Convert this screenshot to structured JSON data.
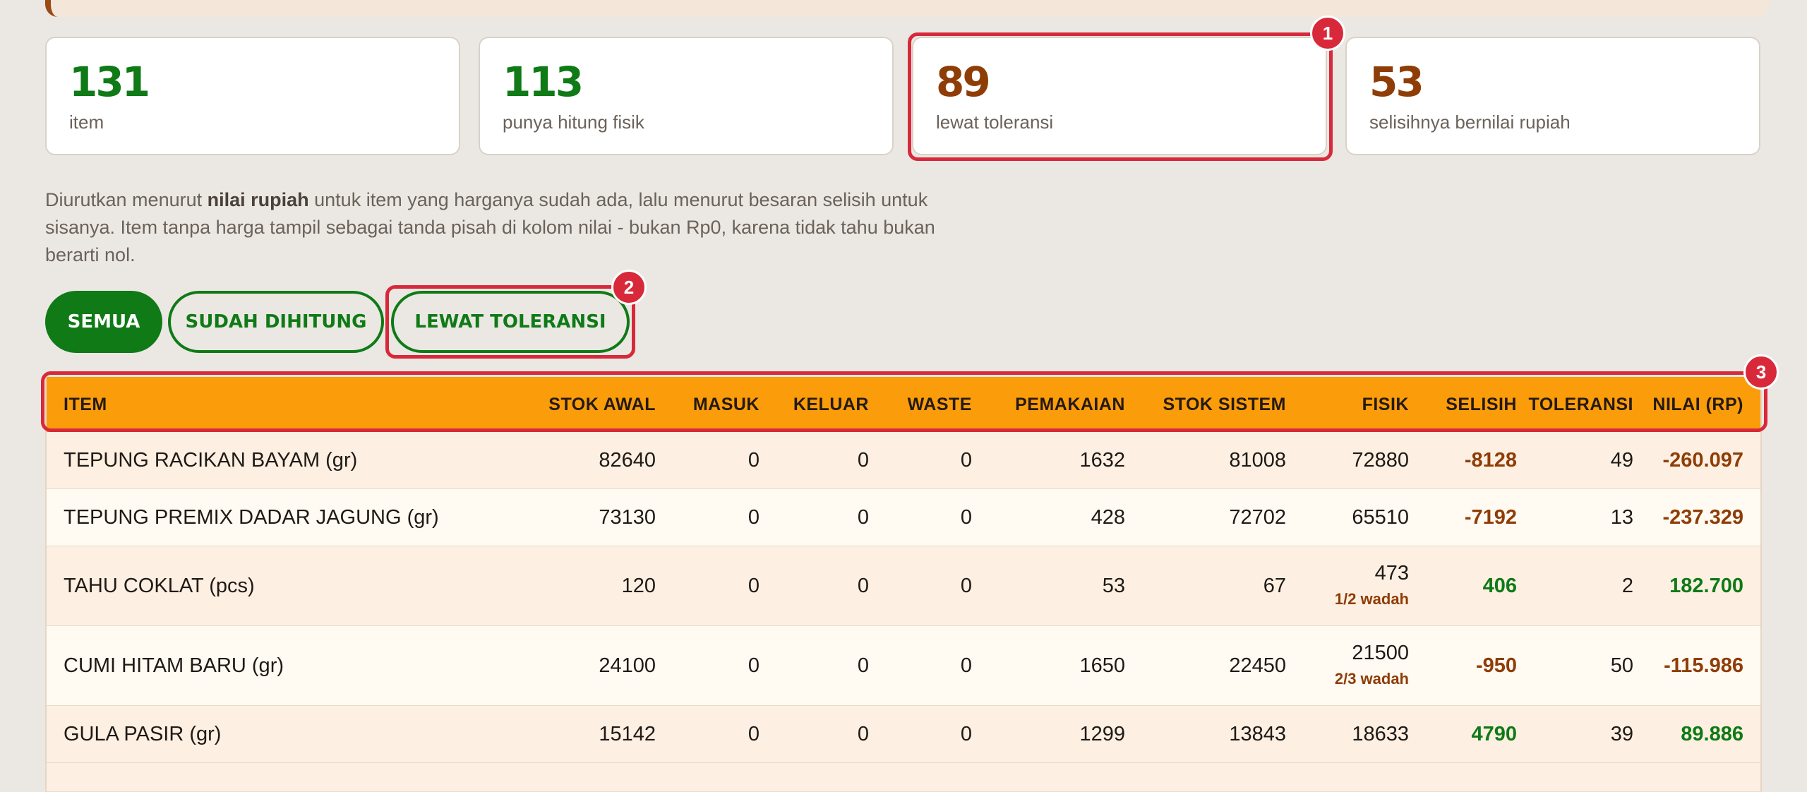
{
  "stats": [
    {
      "value": "131",
      "label": "item",
      "color": "#0f7a16"
    },
    {
      "value": "113",
      "label": "punya hitung fisik",
      "color": "#0f7a16"
    },
    {
      "value": "89",
      "label": "lewat toleransi",
      "color": "#8f3d07"
    },
    {
      "value": "53",
      "label": "selisihnya bernilai rupiah",
      "color": "#8f3d07"
    }
  ],
  "description": {
    "part1": "Diurutkan menurut ",
    "bold": "nilai rupiah",
    "part2": " untuk item yang harganya sudah ada, lalu menurut besaran selisih untuk sisanya. Item tanpa harga tampil sebagai tanda pisah di kolom nilai - bukan Rp0, karena tidak tahu bukan berarti nol."
  },
  "filters": [
    {
      "label": "SEMUA",
      "active": true
    },
    {
      "label": "SUDAH DIHITUNG",
      "active": false
    },
    {
      "label": "LEWAT TOLERANSI",
      "active": false
    }
  ],
  "badges": [
    "1",
    "2",
    "3"
  ],
  "table": {
    "headers": [
      "ITEM",
      "STOK AWAL",
      "MASUK",
      "KELUAR",
      "WASTE",
      "PEMAKAIAN",
      "STOK SISTEM",
      "FISIK",
      "SELISIH",
      "TOLERANSI",
      "NILAI (RP)"
    ],
    "rows": [
      {
        "item": "TEPUNG RACIKAN BAYAM (gr)",
        "stok_awal": "82640",
        "masuk": "0",
        "keluar": "0",
        "waste": "0",
        "pemakaian": "1632",
        "stok_sistem": "81008",
        "fisik": "72880",
        "fisik_sub": "",
        "selisih": "-8128",
        "toleransi": "49",
        "nilai": "-260.097",
        "sign": "neg"
      },
      {
        "item": "TEPUNG PREMIX DADAR JAGUNG (gr)",
        "stok_awal": "73130",
        "masuk": "0",
        "keluar": "0",
        "waste": "0",
        "pemakaian": "428",
        "stok_sistem": "72702",
        "fisik": "65510",
        "fisik_sub": "",
        "selisih": "-7192",
        "toleransi": "13",
        "nilai": "-237.329",
        "sign": "neg"
      },
      {
        "item": "TAHU COKLAT (pcs)",
        "stok_awal": "120",
        "masuk": "0",
        "keluar": "0",
        "waste": "0",
        "pemakaian": "53",
        "stok_sistem": "67",
        "fisik": "473",
        "fisik_sub": "1/2 wadah",
        "selisih": "406",
        "toleransi": "2",
        "nilai": "182.700",
        "sign": "pos"
      },
      {
        "item": "CUMI HITAM BARU (gr)",
        "stok_awal": "24100",
        "masuk": "0",
        "keluar": "0",
        "waste": "0",
        "pemakaian": "1650",
        "stok_sistem": "22450",
        "fisik": "21500",
        "fisik_sub": "2/3 wadah",
        "selisih": "-950",
        "toleransi": "50",
        "nilai": "-115.986",
        "sign": "neg"
      },
      {
        "item": "GULA PASIR (gr)",
        "stok_awal": "15142",
        "masuk": "0",
        "keluar": "0",
        "waste": "0",
        "pemakaian": "1299",
        "stok_sistem": "13843",
        "fisik": "18633",
        "fisik_sub": "",
        "selisih": "4790",
        "toleransi": "39",
        "nilai": "89.886",
        "sign": "pos"
      }
    ]
  }
}
